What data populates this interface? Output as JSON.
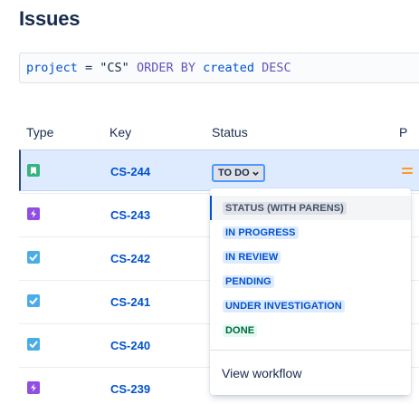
{
  "page": {
    "title": "Issues"
  },
  "search": {
    "tokens": [
      {
        "text": "project",
        "kind": "field"
      },
      {
        "text": " = ",
        "kind": "op"
      },
      {
        "text": "\"CS\"",
        "kind": "str"
      },
      {
        "text": " ORDER BY ",
        "kind": "kw"
      },
      {
        "text": "created",
        "kind": "field"
      },
      {
        "text": " DESC",
        "kind": "kw"
      }
    ]
  },
  "table": {
    "columns": [
      "Type",
      "Key",
      "Status",
      "P"
    ],
    "rows": [
      {
        "type_icon": "story-icon",
        "key": "CS-244",
        "status": "TO DO",
        "priority_icon": "priority-medium-icon",
        "selected": true
      },
      {
        "type_icon": "epic-icon",
        "key": "CS-243"
      },
      {
        "type_icon": "task-icon",
        "key": "CS-242"
      },
      {
        "type_icon": "task-icon",
        "key": "CS-241"
      },
      {
        "type_icon": "task-icon",
        "key": "CS-240"
      },
      {
        "type_icon": "epic-icon",
        "key": "CS-239"
      }
    ]
  },
  "status_dropdown": {
    "options": [
      {
        "label": "STATUS (WITH PARENS)",
        "tone": "neutral",
        "active": true
      },
      {
        "label": "IN PROGRESS",
        "tone": "blue"
      },
      {
        "label": "IN REVIEW",
        "tone": "blue"
      },
      {
        "label": "PENDING",
        "tone": "blue"
      },
      {
        "label": "UNDER INVESTIGATION",
        "tone": "blue"
      },
      {
        "label": "DONE",
        "tone": "green"
      }
    ],
    "footer_link": "View workflow"
  },
  "colors": {
    "link": "#0052cc",
    "story": "#36b37e",
    "epic": "#904ee2",
    "task": "#4bade8",
    "priority": "#ff991f",
    "selected_row": "#deebff"
  }
}
